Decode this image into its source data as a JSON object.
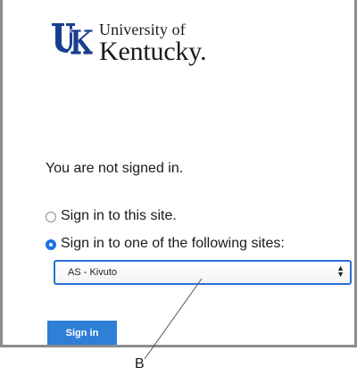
{
  "logo": {
    "line1": "University of",
    "line2": "Kentucky.",
    "mark_color": "#1a3e8f"
  },
  "status_text": "You are not signed in.",
  "options": [
    {
      "label": "Sign in to this site.",
      "checked": false
    },
    {
      "label": "Sign in to one of the following sites:",
      "checked": true
    }
  ],
  "site_select": {
    "selected": "AS - Kivuto"
  },
  "signin_button": {
    "label": "Sign in",
    "color": "#2f7fd6"
  },
  "callout": {
    "label": "B"
  },
  "colors": {
    "accent": "#1a73e8",
    "border": "#8c8c8c"
  }
}
